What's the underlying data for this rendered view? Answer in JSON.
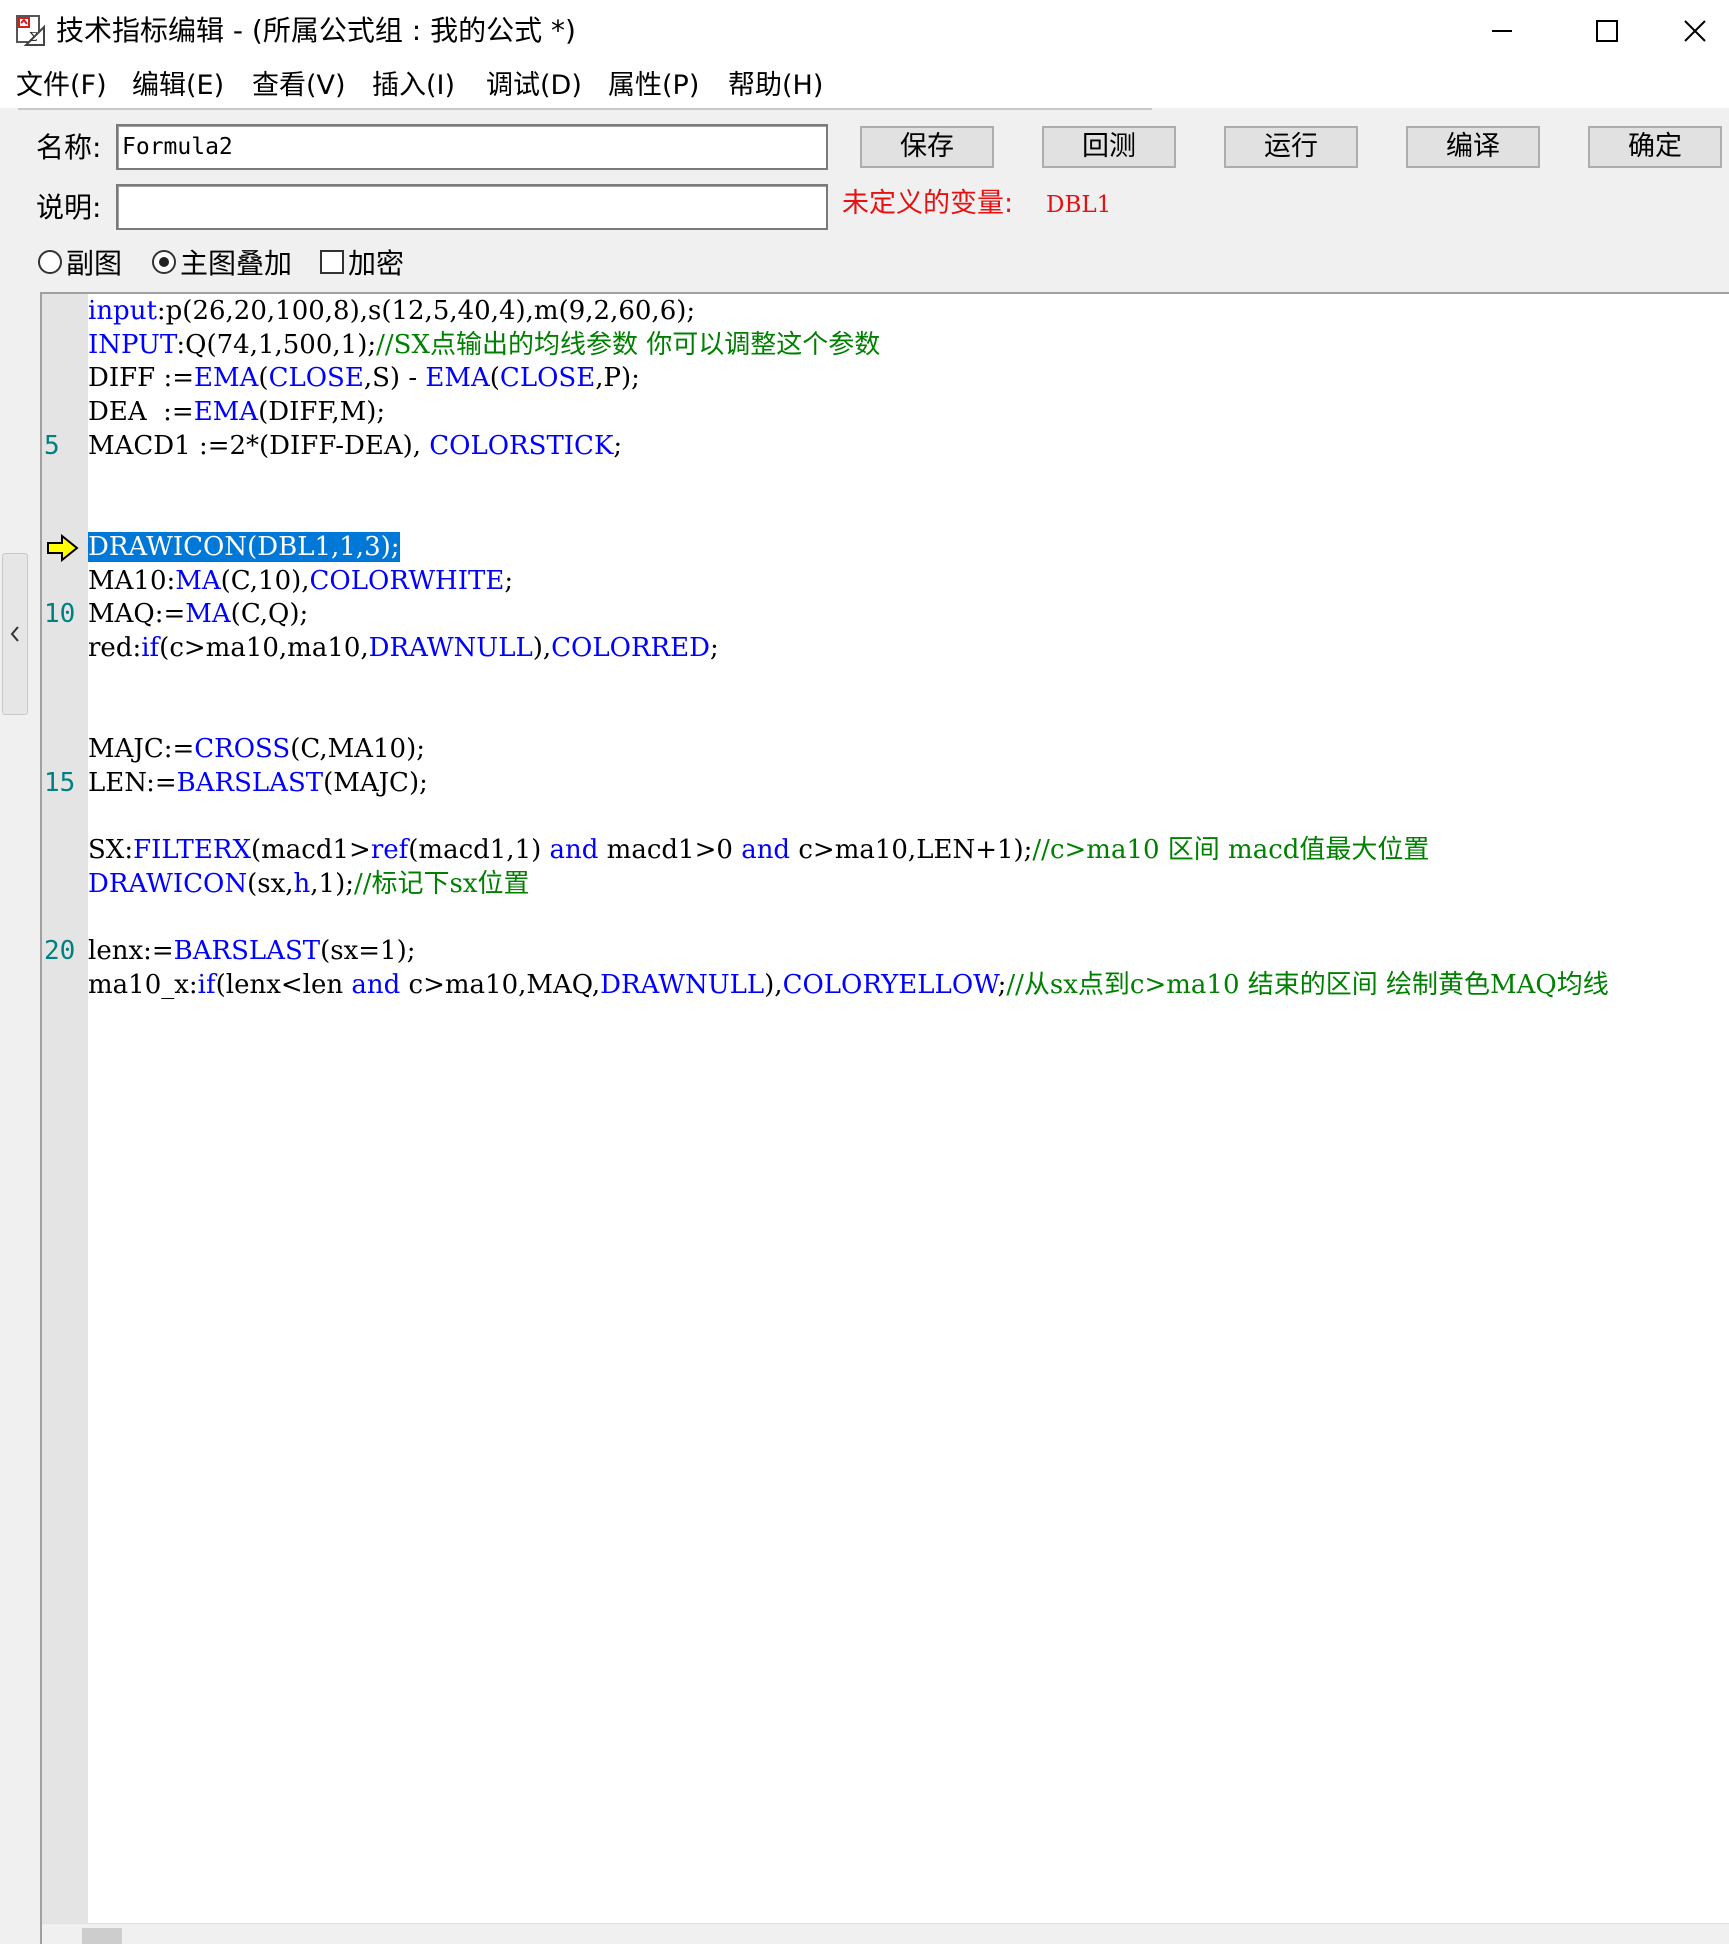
{
  "window": {
    "title": "技术指标编辑 - (所属公式组 : 我的公式 *)",
    "controls": [
      "minimize-icon",
      "maximize-icon",
      "close-icon"
    ]
  },
  "menu": [
    "文件(F)",
    "编辑(E)",
    "查看(V)",
    "插入(I)",
    "调试(D)",
    "属性(P)",
    "帮助(H)"
  ],
  "form": {
    "name_label": "名称:",
    "name_value": "Formula2",
    "desc_label": "说明:",
    "desc_value": "",
    "undefined_label": "未定义的变量:",
    "undefined_value": "DBL1"
  },
  "buttons": {
    "save": "保存",
    "backtest": "回测",
    "run": "运行",
    "compile": "编译",
    "ok": "确定"
  },
  "options": {
    "sub_chart": "副图",
    "main_overlay": "主图叠加",
    "encrypt": "加密",
    "selected": "main_overlay",
    "encrypt_checked": false
  },
  "editor": {
    "current_line": 8,
    "lines": [
      {
        "n": 1,
        "ln": "",
        "tokens": [
          [
            "kw",
            "input"
          ],
          [
            "pl",
            ":p(26,20,100,8),s(12,5,40,4),m(9,2,60,6);"
          ]
        ]
      },
      {
        "n": 2,
        "ln": "",
        "tokens": [
          [
            "kw",
            "INPUT"
          ],
          [
            "pl",
            ":Q(74,1,500,1);"
          ],
          [
            "cm",
            "//SX点输出的均线参数 你可以调整这个参数"
          ]
        ]
      },
      {
        "n": 3,
        "ln": "",
        "tokens": [
          [
            "pl",
            "DIFF :="
          ],
          [
            "kw",
            "EMA"
          ],
          [
            "pl",
            "("
          ],
          [
            "kw",
            "CLOSE"
          ],
          [
            "pl",
            ",S) - "
          ],
          [
            "kw",
            "EMA"
          ],
          [
            "pl",
            "("
          ],
          [
            "kw",
            "CLOSE"
          ],
          [
            "pl",
            ",P);"
          ]
        ]
      },
      {
        "n": 4,
        "ln": "",
        "tokens": [
          [
            "pl",
            "DEA  :="
          ],
          [
            "kw",
            "EMA"
          ],
          [
            "pl",
            "(DIFF,M);"
          ]
        ]
      },
      {
        "n": 5,
        "ln": "5",
        "tokens": [
          [
            "pl",
            "MACD1 :=2*(DIFF-DEA), "
          ],
          [
            "kw",
            "COLORSTICK"
          ],
          [
            "pl",
            ";"
          ]
        ]
      },
      {
        "n": 6,
        "ln": "",
        "tokens": []
      },
      {
        "n": 7,
        "ln": "",
        "tokens": []
      },
      {
        "n": 8,
        "ln": "",
        "tokens": [
          [
            "sel",
            "DRAWICON(DBL1,1,3);"
          ]
        ]
      },
      {
        "n": 9,
        "ln": "",
        "tokens": [
          [
            "pl",
            "MA10:"
          ],
          [
            "kw",
            "MA"
          ],
          [
            "pl",
            "(C,10),"
          ],
          [
            "kw",
            "COLORWHITE"
          ],
          [
            "pl",
            ";"
          ]
        ]
      },
      {
        "n": 10,
        "ln": "10",
        "tokens": [
          [
            "pl",
            "MAQ:="
          ],
          [
            "kw",
            "MA"
          ],
          [
            "pl",
            "(C,Q);"
          ]
        ]
      },
      {
        "n": 11,
        "ln": "",
        "tokens": [
          [
            "pl",
            "red:"
          ],
          [
            "kw",
            "if"
          ],
          [
            "pl",
            "(c>ma10,ma10,"
          ],
          [
            "kw",
            "DRAWNULL"
          ],
          [
            "pl",
            "),"
          ],
          [
            "kw",
            "COLORRED"
          ],
          [
            "pl",
            ";"
          ]
        ]
      },
      {
        "n": 12,
        "ln": "",
        "tokens": []
      },
      {
        "n": 13,
        "ln": "",
        "tokens": []
      },
      {
        "n": 14,
        "ln": "",
        "tokens": [
          [
            "pl",
            "MAJC:="
          ],
          [
            "kw",
            "CROSS"
          ],
          [
            "pl",
            "(C,MA10);"
          ]
        ]
      },
      {
        "n": 15,
        "ln": "15",
        "tokens": [
          [
            "pl",
            "LEN:="
          ],
          [
            "kw",
            "BARSLAST"
          ],
          [
            "pl",
            "(MAJC);"
          ]
        ]
      },
      {
        "n": 16,
        "ln": "",
        "tokens": []
      },
      {
        "n": 17,
        "ln": "",
        "tokens": [
          [
            "pl",
            "SX:"
          ],
          [
            "kw",
            "FILTERX"
          ],
          [
            "pl",
            "(macd1>"
          ],
          [
            "kw",
            "ref"
          ],
          [
            "pl",
            "(macd1,1) "
          ],
          [
            "kw",
            "and"
          ],
          [
            "pl",
            " macd1>0 "
          ],
          [
            "kw",
            "and"
          ],
          [
            "pl",
            " c>ma10,LEN+1);"
          ],
          [
            "cm",
            "//c>ma10 区间 macd值最大位置"
          ]
        ]
      },
      {
        "n": 18,
        "ln": "",
        "tokens": [
          [
            "kw",
            "DRAWICON"
          ],
          [
            "pl",
            "(sx,"
          ],
          [
            "kw",
            "h"
          ],
          [
            "pl",
            ",1);"
          ],
          [
            "cm",
            "//标记下sx位置"
          ]
        ]
      },
      {
        "n": 19,
        "ln": "",
        "tokens": []
      },
      {
        "n": 20,
        "ln": "20",
        "tokens": [
          [
            "pl",
            "lenx:="
          ],
          [
            "kw",
            "BARSLAST"
          ],
          [
            "pl",
            "(sx=1);"
          ]
        ]
      },
      {
        "n": 21,
        "ln": "",
        "tokens": [
          [
            "pl",
            "ma10_x:"
          ],
          [
            "kw",
            "if"
          ],
          [
            "pl",
            "(lenx<len "
          ],
          [
            "kw",
            "and"
          ],
          [
            "pl",
            " c>ma10,MAQ,"
          ],
          [
            "kw",
            "DRAWNULL"
          ],
          [
            "pl",
            "),"
          ],
          [
            "kw",
            "COLORYELLOW"
          ],
          [
            "pl",
            ";"
          ],
          [
            "cm",
            "//从sx点到c>ma10 结束的区间 绘制黄色MAQ均线"
          ]
        ]
      }
    ]
  },
  "colors": {
    "keyword": "#0000ff",
    "comment": "#008000",
    "line_number": "#008080",
    "selection": "#0078d7",
    "warning": "#e81010",
    "gutter": "#e4e4e4"
  }
}
